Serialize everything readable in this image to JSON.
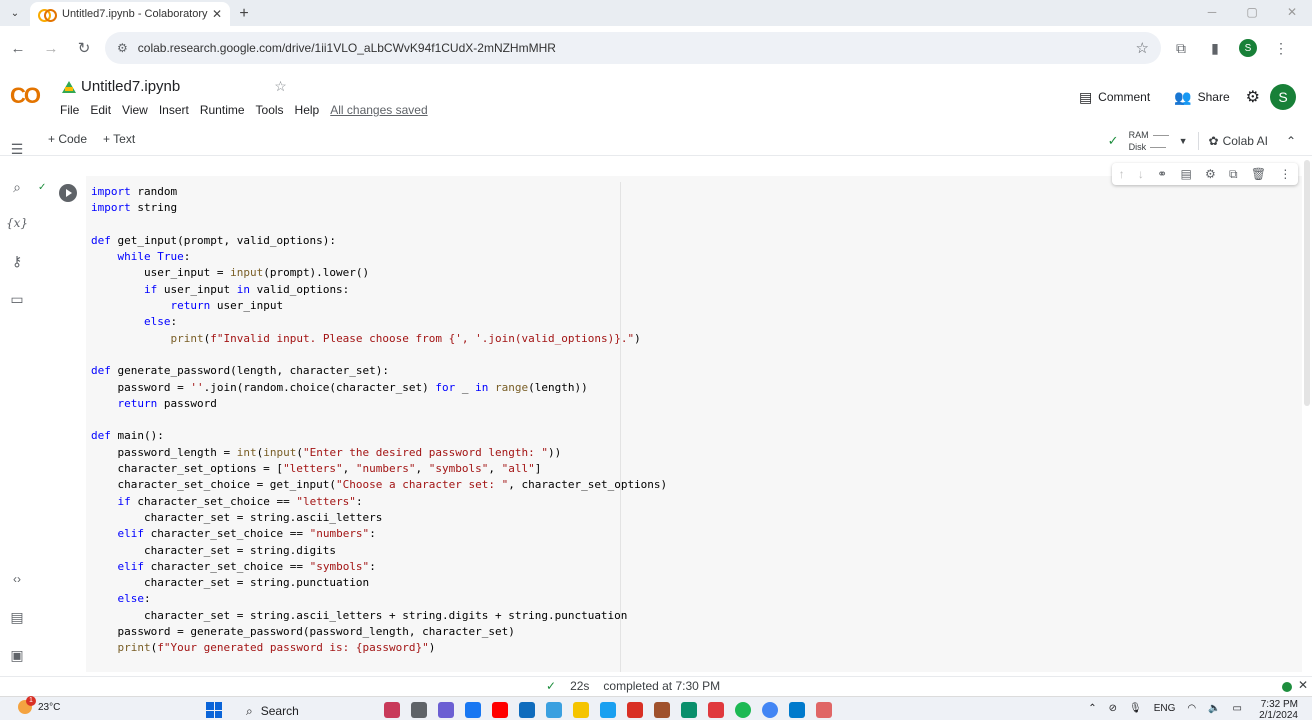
{
  "browser": {
    "tab_title": "Untitled7.ipynb - Colaboratory",
    "close_glyph": "✕",
    "new_tab_glyph": "+",
    "url": "colab.research.google.com/drive/1ii1VLO_aLbCWvK94f1CUdX-2mNZHmMHR",
    "profile_initial": "S"
  },
  "colab": {
    "logo": "CO",
    "notebook_title": "Untitled7.ipynb",
    "menu": [
      "File",
      "Edit",
      "View",
      "Insert",
      "Runtime",
      "Tools",
      "Help"
    ],
    "save_status": "All changes saved",
    "comment_label": "Comment",
    "share_label": "Share",
    "user_initial": "S"
  },
  "toolbar": {
    "add_code_label": "+ Code",
    "add_text_label": "+ Text",
    "ram_label": "RAM",
    "disk_label": "Disk",
    "colab_ai_label": "Colab AI"
  },
  "icons": {
    "rail": [
      "toc-icon",
      "search-icon",
      "variables-icon",
      "secrets-icon",
      "files-icon",
      "code-snippets-icon",
      "command-palette-icon",
      "terminal-icon"
    ],
    "cell_toolbar": [
      "move-up-icon",
      "move-down-icon",
      "link-icon",
      "comment-icon",
      "settings-icon",
      "mirror-cell-icon",
      "delete-icon",
      "more-icon"
    ]
  },
  "cell": {
    "status_glyph": "✓",
    "code": [
      "import random",
      "import string",
      "",
      "def get_input(prompt, valid_options):",
      "    while True:",
      "        user_input = input(prompt).lower()",
      "        if user_input in valid_options:",
      "            return user_input",
      "        else:",
      "            print(f\"Invalid input. Please choose from {', '.join(valid_options)}.\")",
      "",
      "def generate_password(length, character_set):",
      "    password = ''.join(random.choice(character_set) for _ in range(length))",
      "    return password",
      "",
      "def main():",
      "    password_length = int(input(\"Enter the desired password length: \"))",
      "    character_set_options = [\"letters\", \"numbers\", \"symbols\", \"all\"]",
      "    character_set_choice = get_input(\"Choose a character set: \", character_set_options)",
      "    if character_set_choice == \"letters\":",
      "        character_set = string.ascii_letters",
      "    elif character_set_choice == \"numbers\":",
      "        character_set = string.digits",
      "    elif character_set_choice == \"symbols\":",
      "        character_set = string.punctuation",
      "    else:",
      "        character_set = string.ascii_letters + string.digits + string.punctuation",
      "    password = generate_password(password_length, character_set)",
      "    print(f\"Your generated password is: {password}\")"
    ]
  },
  "statusbar": {
    "duration": "22s",
    "completed": "completed at 7:30 PM",
    "close_glyph": "✕"
  },
  "taskbar": {
    "temperature": "23°C",
    "weather_badge": "1",
    "search_label": "Search",
    "language": "ENG",
    "time": "7:32 PM",
    "date": "2/1/2024"
  },
  "colors": {
    "accent_green": "#188038",
    "colab_orange": "#f9ab00"
  }
}
